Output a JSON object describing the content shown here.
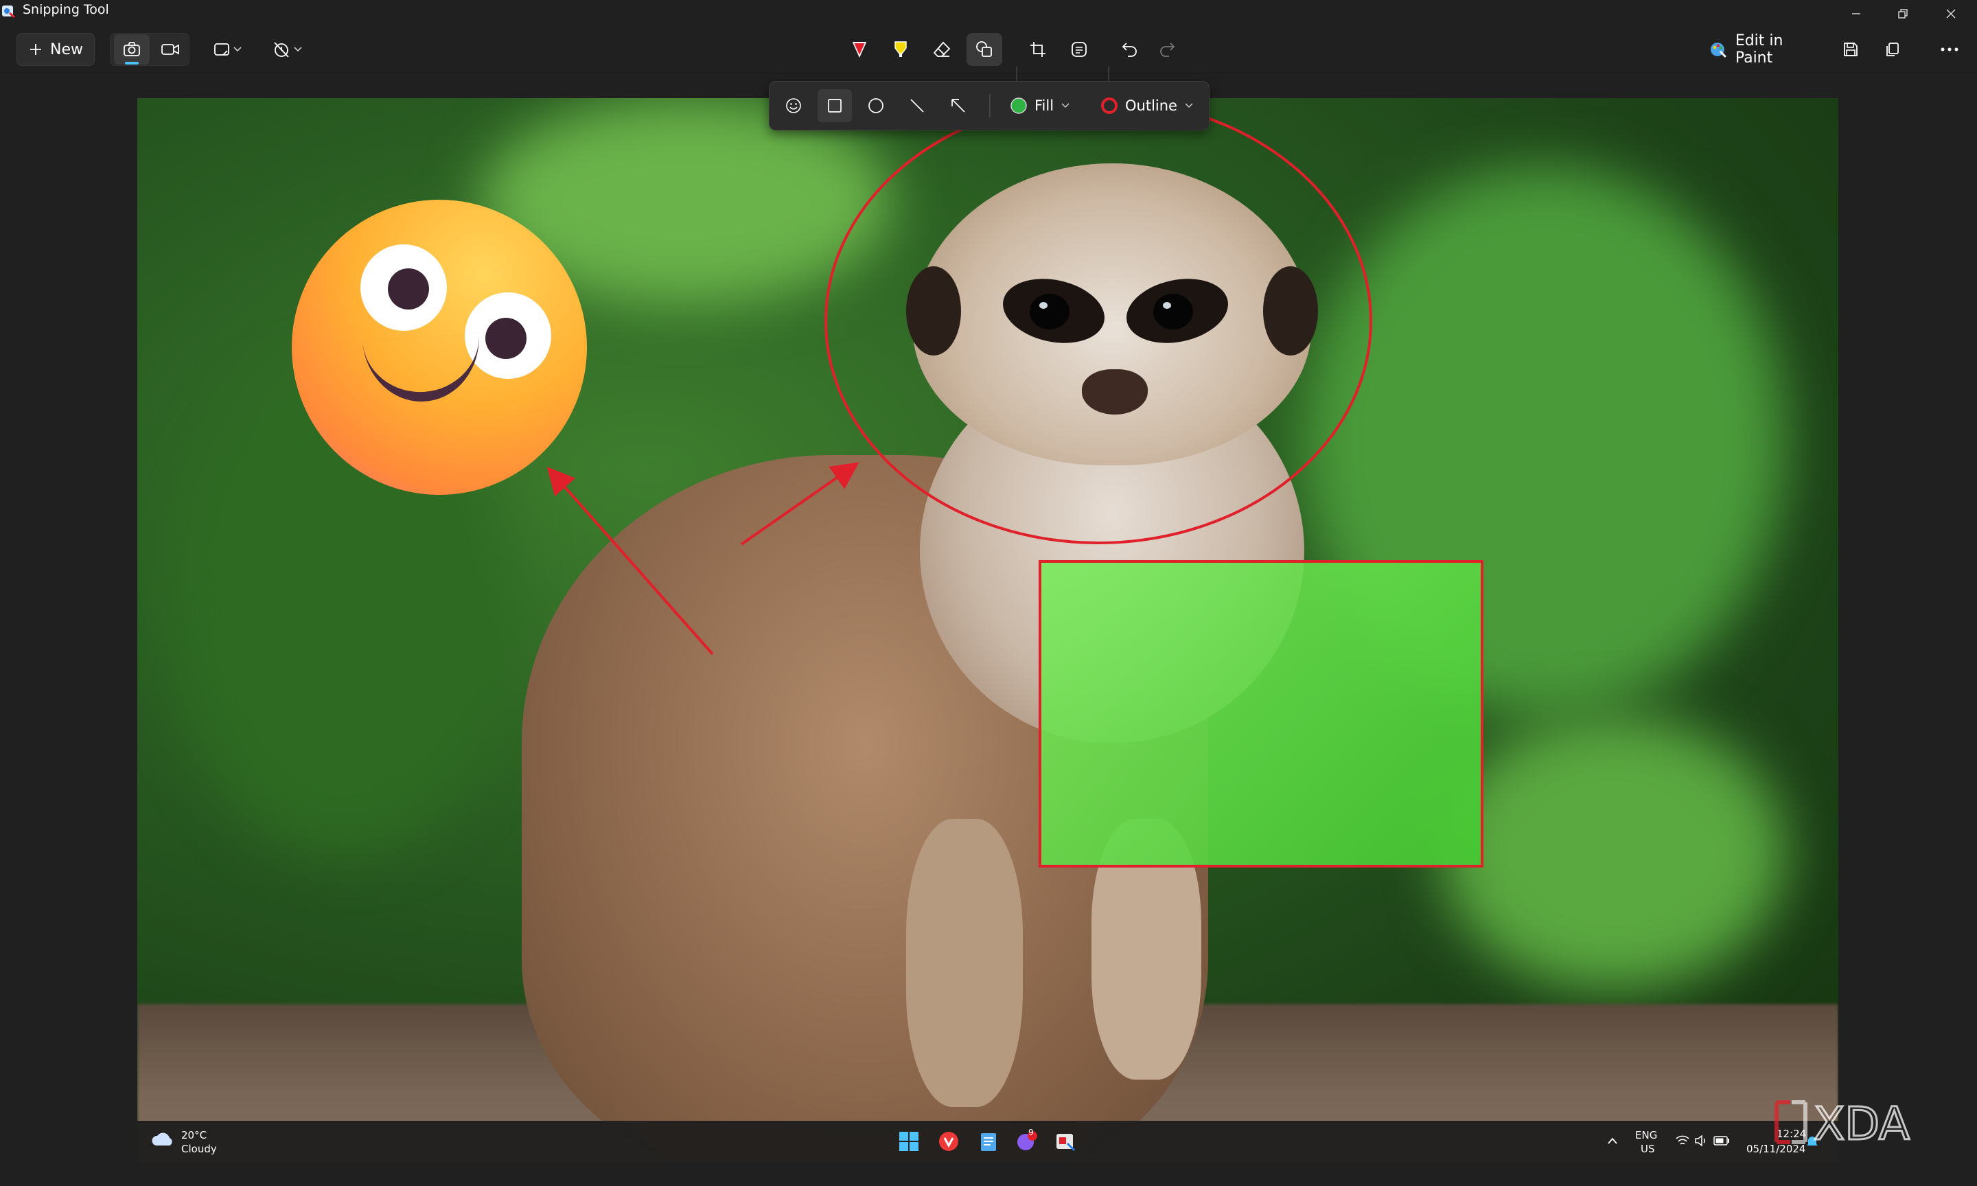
{
  "app": {
    "title": "Snipping Tool"
  },
  "toolbar": {
    "new_label": "New",
    "edit_in_paint_label": "Edit in Paint",
    "icons": [
      "camera-icon",
      "video-icon",
      "snip-shape-icon",
      "timer-icon",
      "pen-icon",
      "highlighter-icon",
      "eraser-icon",
      "shapes-icon",
      "crop-icon",
      "text-actions-icon",
      "undo-icon",
      "redo-icon",
      "paint-icon",
      "save-icon",
      "copy-icon",
      "more-icon"
    ]
  },
  "shape_flyout": {
    "fill_label": "Fill",
    "outline_label": "Outline",
    "fill_color": "#2fb344",
    "outline_color": "#e0202a",
    "selected_tool": "rectangle"
  },
  "taskbar": {
    "weather_temp": "20°C",
    "weather_desc": "Cloudy",
    "lang_top": "ENG",
    "lang_bottom": "US",
    "time": "12:24",
    "date": "05/11/2024",
    "notification_count": "9"
  },
  "watermark": {
    "text": "XDA"
  }
}
